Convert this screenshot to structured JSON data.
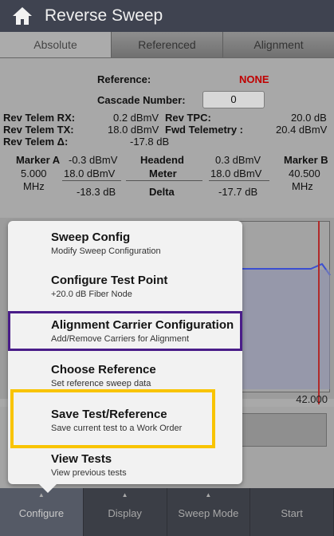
{
  "app": {
    "title": "Reverse Sweep",
    "home_icon": "home-icon"
  },
  "tabs": [
    {
      "label": "Absolute",
      "active": true
    },
    {
      "label": "Referenced",
      "active": false
    },
    {
      "label": "Alignment",
      "active": false
    }
  ],
  "reference": {
    "label": "Reference:",
    "value": "NONE"
  },
  "cascade": {
    "label": "Cascade Number:",
    "value": "0"
  },
  "telemetry": {
    "rx_label": "Rev Telem RX:",
    "rx_value": "0.2 dBmV",
    "tpc_label": "Rev TPC:",
    "tpc_value": "20.0 dB",
    "tx_label": "Rev Telem TX:",
    "tx_value": "18.0 dBmV",
    "fwd_label": "Fwd Telemetry :",
    "fwd_value": "20.4 dBmV",
    "delta_label": "Rev Telem Δ:",
    "delta_value": "-17.8 dB"
  },
  "markers": {
    "a_label": "Marker A",
    "a_freq": "5.000",
    "a_unit": "MHz",
    "a_val1": "-0.3 dBmV",
    "a_val2": "18.0 dBmV",
    "a_val3": "-18.3 dB",
    "headend_label": "Headend",
    "meter_label": "Meter",
    "delta_label": "Delta",
    "b_val1": "0.3 dBmV",
    "b_val2": "18.0 dBmV",
    "b_val3": "-17.7 dB",
    "b_label": "Marker B",
    "b_freq": "40.500",
    "b_unit": "MHz"
  },
  "chart": {
    "x_end": "42.000"
  },
  "menu": {
    "items": [
      {
        "label": "Sweep Config",
        "sub": "Modify Sweep Configuration"
      },
      {
        "label": "Configure Test Point",
        "sub": "+20.0 dB Fiber Node"
      },
      {
        "label": "Alignment Carrier Configuration",
        "sub": "Add/Remove Carriers for Alignment"
      },
      {
        "label": "Choose Reference",
        "sub": "Set reference sweep data"
      },
      {
        "label": "Save Test/Reference",
        "sub": "Save current test to a Work Order"
      },
      {
        "label": "View Tests",
        "sub": "View previous tests"
      }
    ]
  },
  "bottom_nav": [
    {
      "label": "Configure",
      "active": true
    },
    {
      "label": "Display",
      "active": false
    },
    {
      "label": "Sweep Mode",
      "active": false
    },
    {
      "label": "Start",
      "active": false
    }
  ],
  "colors": {
    "accent_red": "#c00000",
    "highlight_purple": "#4a1d89",
    "highlight_yellow": "#f9c400"
  }
}
